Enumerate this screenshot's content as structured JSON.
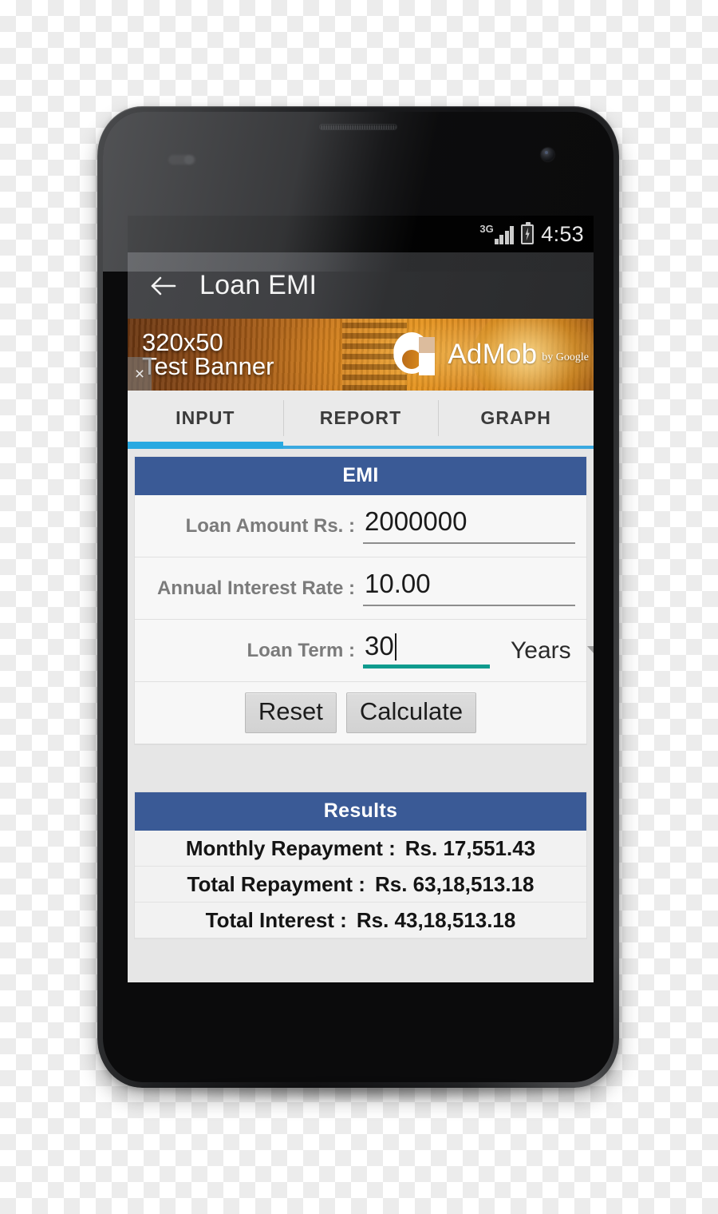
{
  "status_bar": {
    "network_label": "3G",
    "time": "4:53",
    "battery_icon": "battery-charging-icon",
    "signal_icon": "signal-bars-icon"
  },
  "app_bar": {
    "back_icon": "back-arrow-icon",
    "title": "Loan EMI"
  },
  "ad_banner": {
    "line1": "320x50",
    "line2": "Test Banner",
    "brand": "AdMob",
    "brand_suffix": "by Google",
    "close_label": "×",
    "logo_icon": "admob-logo-icon"
  },
  "tabs": [
    {
      "label": "INPUT",
      "active": true
    },
    {
      "label": "REPORT",
      "active": false
    },
    {
      "label": "GRAPH",
      "active": false
    }
  ],
  "emi_card": {
    "header": "EMI",
    "fields": [
      {
        "label": "Loan Amount Rs. :",
        "value": "2000000"
      },
      {
        "label": "Annual Interest Rate :",
        "value": "10.00"
      },
      {
        "label": "Loan Term :",
        "value": "30",
        "unit": "Years"
      }
    ],
    "buttons": {
      "reset": "Reset",
      "calculate": "Calculate"
    }
  },
  "results_card": {
    "header": "Results",
    "rows": [
      {
        "label": "Monthly Repayment :",
        "value": "Rs. 17,551.43"
      },
      {
        "label": "Total Repayment :",
        "value": "Rs. 63,18,513.18"
      },
      {
        "label": "Total Interest :",
        "value": "Rs. 43,18,513.18"
      }
    ]
  },
  "colors": {
    "accent_tab": "#29a9e1",
    "card_header": "#3a5a96",
    "focus_underline": "#0f9b8e",
    "ad_background": "#c8761b"
  }
}
